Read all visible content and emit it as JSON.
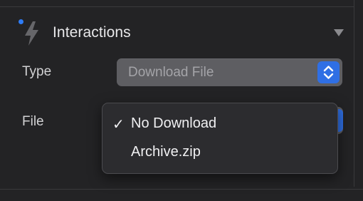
{
  "colors": {
    "background": "#232325",
    "accent": "#2e7cf6",
    "stepper": "#2f6fe4",
    "select_fill": "#5e5e62",
    "menu_fill": "#2c2c2f"
  },
  "section": {
    "title": "Interactions",
    "icon": "lightning-bolt-icon",
    "collapse_icon": "triangle-down-icon"
  },
  "type_row": {
    "label": "Type",
    "value": "Download File",
    "stepper_icon": "up-down-chevron-icon"
  },
  "file_row": {
    "label": "File"
  },
  "dropdown": {
    "items": [
      {
        "label": "No Download",
        "checked": true,
        "check_glyph": "✓"
      },
      {
        "label": "Archive.zip",
        "checked": false
      }
    ]
  }
}
